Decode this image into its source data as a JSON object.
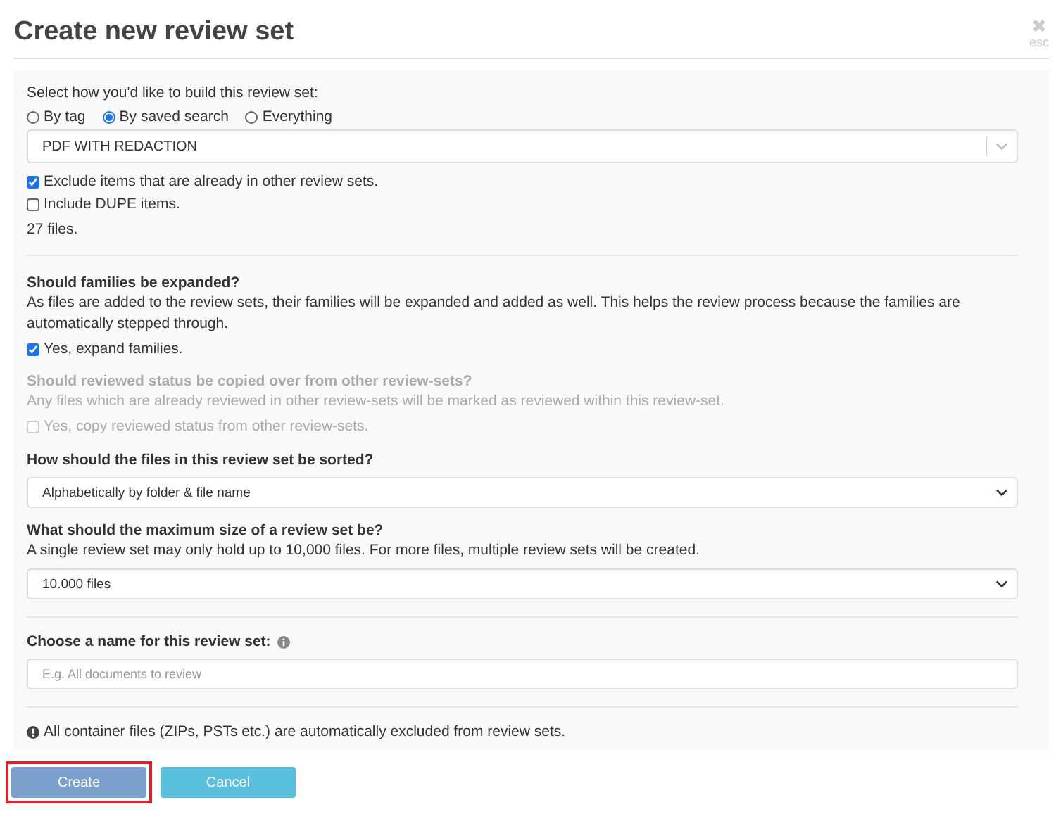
{
  "dialog": {
    "title": "Create new review set",
    "close": {
      "icon": "✖",
      "label": "esc"
    }
  },
  "source": {
    "label": "Select how you'd like to build this review set:",
    "options": [
      {
        "label": "By tag",
        "selected": false
      },
      {
        "label": "By saved search",
        "selected": true
      },
      {
        "label": "Everything",
        "selected": false
      }
    ],
    "search_select": {
      "value": "PDF WITH REDACTION"
    },
    "checks": [
      {
        "label": "Exclude items that are already in other review sets.",
        "checked": true
      },
      {
        "label": "Include DUPE items.",
        "checked": false
      }
    ],
    "count": "27 files."
  },
  "families": {
    "heading": "Should families be expanded?",
    "description": "As files are added to the review sets, their families will be expanded and added as well. This helps the review process because the families are automatically stepped through.",
    "check": {
      "label": "Yes, expand families.",
      "checked": true
    }
  },
  "reviewed_status": {
    "heading": "Should reviewed status be copied over from other review-sets?",
    "description": "Any files which are already reviewed in other review-sets will be marked as reviewed within this review-set.",
    "disabled": true,
    "check": {
      "label": "Yes, copy reviewed status from other review-sets.",
      "checked": false,
      "disabled": true
    }
  },
  "sorting": {
    "heading": "How should the files in this review set be sorted?",
    "value": "Alphabetically by folder & file name"
  },
  "max_size": {
    "heading": "What should the maximum size of a review set be?",
    "description": "A single review set may only hold up to 10,000 files. For more files, multiple review sets will be created.",
    "value": "10.000 files"
  },
  "name": {
    "heading": "Choose a name for this review set:",
    "placeholder": "E.g. All documents to review"
  },
  "note": "All container files (ZIPs, PSTs etc.) are automatically excluded from review sets.",
  "buttons": [
    {
      "label": "Create",
      "kind": "primary",
      "highlighted": true
    },
    {
      "label": "Cancel",
      "kind": "secondary",
      "highlighted": false
    }
  ]
}
